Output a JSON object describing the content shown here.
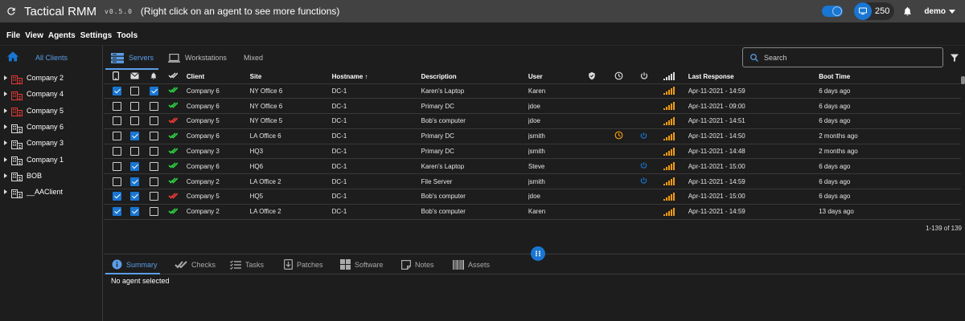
{
  "app": {
    "title": "Tactical RMM",
    "version": "v0.5.0",
    "hint": "(Right click on an agent to see more functions)"
  },
  "topbar": {
    "agent_count": "250",
    "user": "demo"
  },
  "menu": [
    "File",
    "View",
    "Agents",
    "Settings",
    "Tools"
  ],
  "tree": {
    "root_label": "All Clients",
    "clients": [
      {
        "name": "Company 2",
        "status": "red"
      },
      {
        "name": "Company 4",
        "status": "red"
      },
      {
        "name": "Company 5",
        "status": "red"
      },
      {
        "name": "Company 6",
        "status": "normal"
      },
      {
        "name": "Company 3",
        "status": "normal"
      },
      {
        "name": "Company 1",
        "status": "normal"
      },
      {
        "name": "BOB",
        "status": "normal"
      },
      {
        "name": "__AAClient",
        "status": "normal"
      }
    ]
  },
  "tabs": {
    "servers": "Servers",
    "workstations": "Workstations",
    "mixed": "Mixed"
  },
  "search": {
    "placeholder": "Search"
  },
  "columns": {
    "client": "Client",
    "site": "Site",
    "hostname": "Hostname ↑",
    "description": "Description",
    "user": "User",
    "last_response": "Last Response",
    "boot_time": "Boot Time"
  },
  "colors": {
    "accent": "#1976d2",
    "ok": "#2ecc40",
    "fail": "#e53935",
    "signal": "#f39c12",
    "pending": "#f39c12"
  },
  "rows": [
    {
      "m": true,
      "e": false,
      "a": true,
      "check": "ok",
      "client": "Company 6",
      "site": "NY Office 6",
      "host": "DC-1",
      "desc": "Karen's Laptop",
      "user": "Karen",
      "pending": false,
      "reboot": false,
      "last": "Apr-11-2021 - 14:59",
      "boot": "6 days ago"
    },
    {
      "m": false,
      "e": false,
      "a": false,
      "check": "ok",
      "client": "Company 6",
      "site": "NY Office 6",
      "host": "DC-1",
      "desc": "Primary DC",
      "user": "jdoe",
      "pending": false,
      "reboot": false,
      "last": "Apr-11-2021 - 09:00",
      "boot": "6 days ago"
    },
    {
      "m": false,
      "e": false,
      "a": false,
      "check": "fail",
      "client": "Company 5",
      "site": "NY Office 5",
      "host": "DC-1",
      "desc": "Bob's computer",
      "user": "jdoe",
      "pending": false,
      "reboot": false,
      "last": "Apr-11-2021 - 14:51",
      "boot": "6 days ago"
    },
    {
      "m": false,
      "e": true,
      "a": false,
      "check": "ok",
      "client": "Company 6",
      "site": "LA Office 6",
      "host": "DC-1",
      "desc": "Primary DC",
      "user": "jsmith",
      "pending": true,
      "reboot": true,
      "last": "Apr-11-2021 - 14:50",
      "boot": "2 months ago"
    },
    {
      "m": false,
      "e": false,
      "a": false,
      "check": "ok",
      "client": "Company 3",
      "site": "HQ3",
      "host": "DC-1",
      "desc": "Primary DC",
      "user": "jsmith",
      "pending": false,
      "reboot": false,
      "last": "Apr-11-2021 - 14:48",
      "boot": "2 months ago"
    },
    {
      "m": false,
      "e": true,
      "a": false,
      "check": "ok",
      "client": "Company 6",
      "site": "HQ6",
      "host": "DC-1",
      "desc": "Karen's Laptop",
      "user": "Steve",
      "pending": false,
      "reboot": true,
      "last": "Apr-11-2021 - 15:00",
      "boot": "6 days ago"
    },
    {
      "m": false,
      "e": true,
      "a": false,
      "check": "ok",
      "client": "Company 2",
      "site": "LA Office 2",
      "host": "DC-1",
      "desc": "File Server",
      "user": "jsmith",
      "pending": false,
      "reboot": true,
      "last": "Apr-11-2021 - 14:59",
      "boot": "6 days ago"
    },
    {
      "m": true,
      "e": true,
      "a": false,
      "check": "fail",
      "client": "Company 5",
      "site": "HQ5",
      "host": "DC-1",
      "desc": "Bob's computer",
      "user": "jdoe",
      "pending": false,
      "reboot": false,
      "last": "Apr-11-2021 - 15:00",
      "boot": "6 days ago"
    },
    {
      "m": true,
      "e": true,
      "a": false,
      "check": "ok",
      "client": "Company 2",
      "site": "LA Office 2",
      "host": "DC-1",
      "desc": "Bob's computer",
      "user": "Karen",
      "pending": false,
      "reboot": false,
      "last": "Apr-11-2021 - 14:59",
      "boot": "13 days ago"
    }
  ],
  "pager": "1-139 of 139",
  "bottom_tabs": {
    "summary": "Summary",
    "checks": "Checks",
    "tasks": "Tasks",
    "patches": "Patches",
    "software": "Software",
    "notes": "Notes",
    "assets": "Assets"
  },
  "no_agent": "No agent selected"
}
